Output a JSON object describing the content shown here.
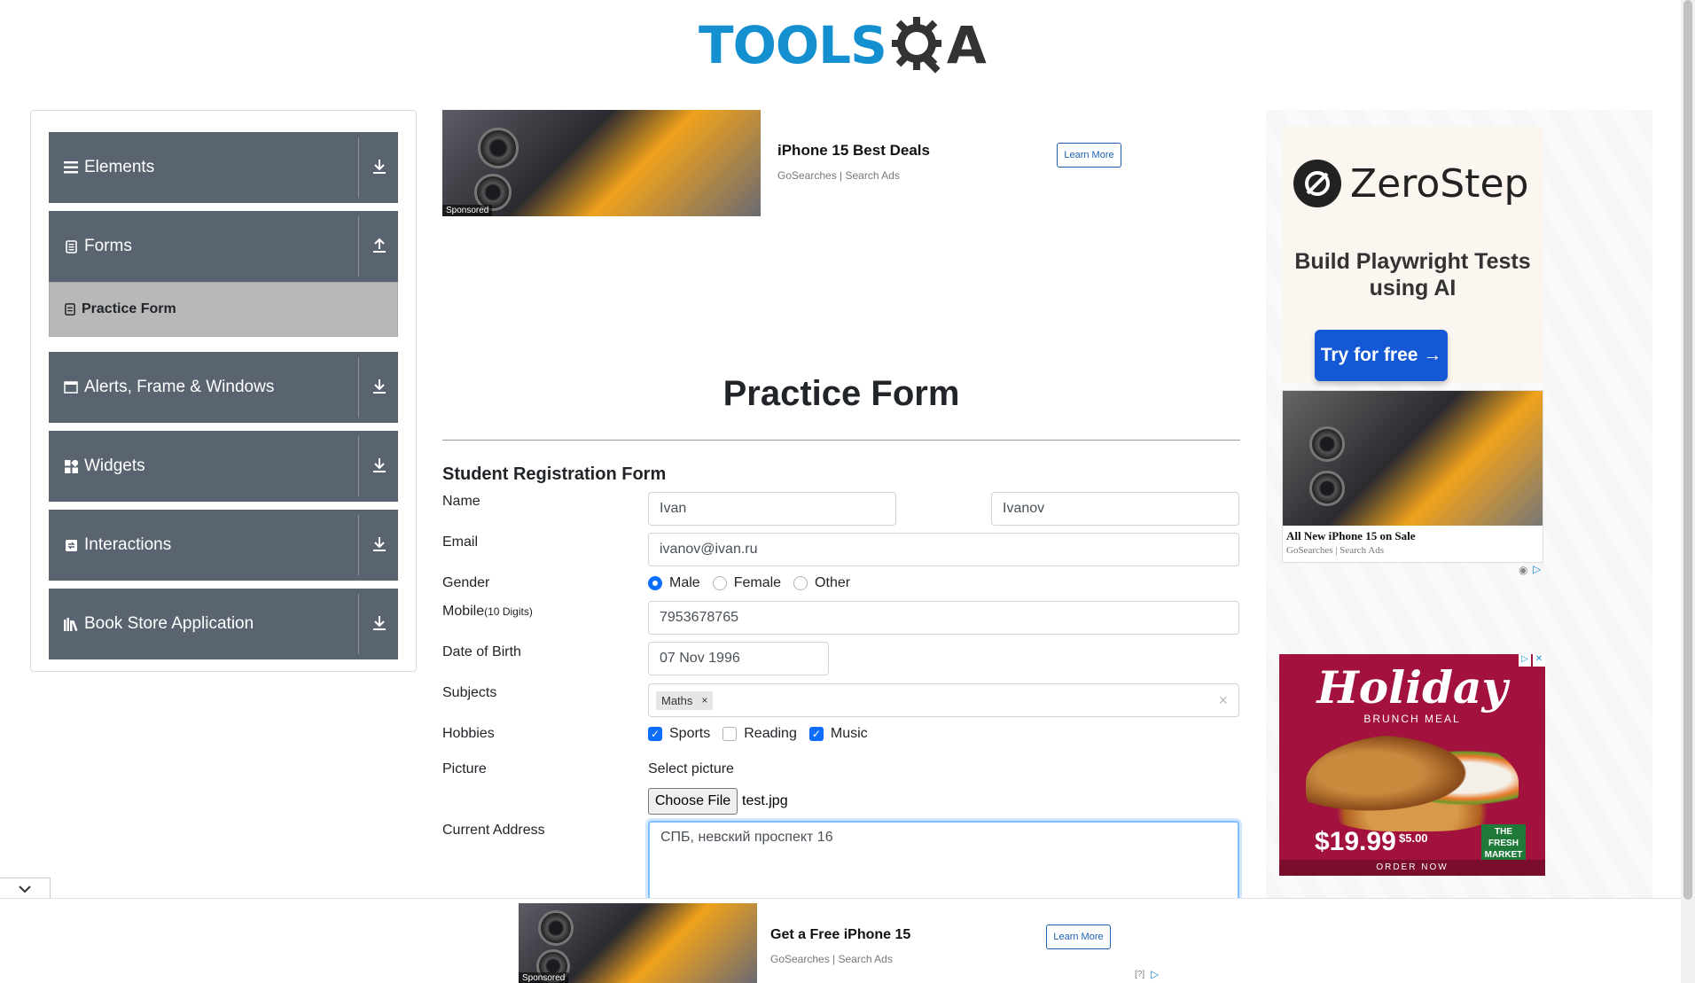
{
  "header": {
    "logo_text": "TOOLS",
    "logo_suffix": "A"
  },
  "sidebar": {
    "groups": [
      {
        "label": "Elements",
        "icon": "hamburger-icon"
      },
      {
        "label": "Forms",
        "icon": "document-icon"
      },
      {
        "label": "Alerts, Frame & Windows",
        "icon": "window-icon"
      },
      {
        "label": "Widgets",
        "icon": "widgets-icon"
      },
      {
        "label": "Interactions",
        "icon": "interactions-icon"
      },
      {
        "label": "Book Store Application",
        "icon": "library-icon"
      }
    ],
    "active_subitem": "Practice Form"
  },
  "top_ad": {
    "title": "iPhone 15 Best Deals",
    "source": "GoSearches | Search Ads",
    "button": "Learn More",
    "sponsored": "Sponsored"
  },
  "form": {
    "page_title": "Practice Form",
    "section_title": "Student Registration Form",
    "labels": {
      "name": "Name",
      "email": "Email",
      "gender": "Gender",
      "mobile": "Mobile",
      "mobile_hint": "(10 Digits)",
      "dob": "Date of Birth",
      "subjects": "Subjects",
      "hobbies": "Hobbies",
      "picture": "Picture",
      "address": "Current Address"
    },
    "first_name": "Ivan",
    "last_name": "Ivanov",
    "email": "ivanov@ivan.ru",
    "gender_options": [
      "Male",
      "Female",
      "Other"
    ],
    "gender_selected": "Male",
    "mobile": "7953678765",
    "dob": "07 Nov 1996",
    "subjects": [
      "Maths"
    ],
    "subject_remove": "×",
    "subjects_clear": "×",
    "hobbies": [
      {
        "label": "Sports",
        "checked": true
      },
      {
        "label": "Reading",
        "checked": false
      },
      {
        "label": "Music",
        "checked": true
      }
    ],
    "picture_prompt": "Select picture",
    "choose_file": "Choose File",
    "file_name": "test.jpg",
    "address": "СПБ, невский проспект 16"
  },
  "right_ad": {
    "brand": "ZeroStep",
    "tagline": "Build Playwright Tests using AI",
    "cta": "Try for free →",
    "iphone_title": "All New iPhone 15 on Sale",
    "iphone_source": "GoSearches | Search Ads",
    "holiday_title": "Holiday",
    "holiday_sub": "BRUNCH MEAL",
    "holiday_price": "$19.99",
    "holiday_small": "$5.00",
    "holiday_badge": "THE FRESH MARKET",
    "holiday_order": "ORDER NOW"
  },
  "bottom_ad": {
    "title": "Get a Free iPhone 15",
    "source": "GoSearches | Search Ads",
    "button": "Learn More",
    "sponsored": "Sponsored",
    "info": "[?]"
  },
  "colors": {
    "accent": "#0d6efd",
    "sidebar_bg": "#5a6470",
    "logo_blue": "#1490d1"
  }
}
